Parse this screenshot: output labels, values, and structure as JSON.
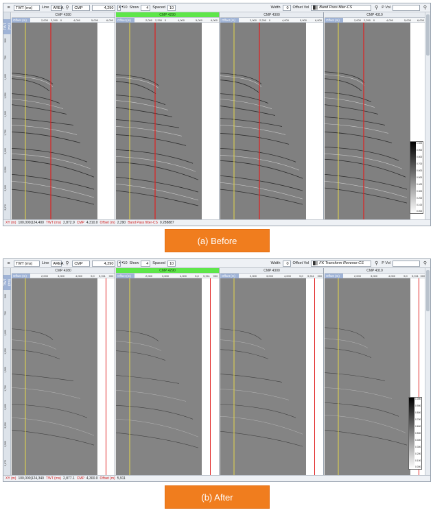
{
  "colors": {
    "selected_header": "#5ee64a",
    "caption_bg": "#f07d1e",
    "guide_red": "#e02020",
    "guide_yellow": "#e6d84a",
    "seismic_bg": "#808080"
  },
  "before": {
    "toolbar": {
      "vertical_icon": "list-icon",
      "twt_select": "TWT (ms)",
      "line_label": "Line",
      "area_value": "AREA",
      "search_icon": "search-icon",
      "cmp_select": "CMP",
      "cmp_value": "4,290",
      "show_count": "10",
      "show_label": "Show",
      "show_value": "4",
      "spaced_label": "Spaced",
      "spaced_value": "10",
      "width_label": "Width",
      "width_value": "0",
      "offset_vol_label": "Offset Vol",
      "offset_vol_value": "Band Pass filter-CS",
      "pvol_label": "P Vol",
      "pvol_value": ""
    },
    "axis": {
      "title": "TWT (ms)",
      "ticks": [
        "500",
        "750",
        "1,000",
        "1,250",
        "1,500",
        "1,750",
        "2,000",
        "2,250",
        "2,500",
        "2,670"
      ]
    },
    "offset_title": "Offset (m)",
    "panels": [
      {
        "header": "CMP 4280",
        "ticks": [
          "2,000",
          "2,290",
          "0",
          "4,000",
          "5,000",
          "6,000"
        ]
      },
      {
        "header": "CMP 4290",
        "ticks": [
          "2,000",
          "2,290",
          "0",
          "4,000",
          "5,000",
          "6,000"
        ]
      },
      {
        "header": "CMP 4300",
        "ticks": [
          "2,000",
          "2,290",
          "0",
          "4,000",
          "5,000",
          "6,000"
        ]
      },
      {
        "header": "CMP 4310",
        "ticks": [
          "2,000",
          "2,290",
          "0",
          "4,000",
          "5,000",
          "6,000"
        ]
      }
    ],
    "colorbar": {
      "labels": [
        "1.000",
        "0.900",
        "0.800",
        "0.700",
        "0.600",
        "0.500",
        "0.400",
        "0.300",
        "0.200",
        "0.100",
        "0.000"
      ]
    },
    "status": {
      "xy_label": "XY (m)",
      "xy_value": "100,000|124,400",
      "twt_label": "TWT (ms)",
      "twt_value": "2,872.9",
      "cmp_label": "CMP",
      "cmp_value": "4,310.0",
      "offset_label": "Offset (m)",
      "offset_value": "2,290",
      "vol_label": "Band Pass filter-CS",
      "vol_value": "0.288887"
    },
    "caption": "(a) Before"
  },
  "after": {
    "toolbar": {
      "vertical_icon": "list-icon",
      "twt_select": "TWT (ms)",
      "line_label": "Line",
      "area_value": "AREA",
      "search_icon": "search-icon",
      "cmp_select": "CMP",
      "cmp_value": "4,290",
      "show_count": "10",
      "show_label": "Show",
      "show_value": "4",
      "spaced_label": "Spaced",
      "spaced_value": "10",
      "width_label": "Width",
      "width_value": "0",
      "offset_vol_label": "Offset Vol",
      "offset_vol_value": "FK Transform Reverse-CS",
      "pvol_label": "P Vol",
      "pvol_value": ""
    },
    "axis": {
      "title": "TWT (ms)",
      "ticks": [
        "500",
        "750",
        "1,000",
        "1,250",
        "1,500",
        "1,750",
        "2,000",
        "2,250",
        "2,500",
        "2,670"
      ]
    },
    "offset_title": "Offset (m)",
    "panels": [
      {
        "header": "CMP 4280",
        "ticks": [
          "2,000",
          "3,000",
          "4,000",
          "5,0",
          "5,911",
          "000"
        ]
      },
      {
        "header": "CMP 4290",
        "ticks": [
          "2,000",
          "3,000",
          "4,000",
          "5,0",
          "5,911",
          "000"
        ]
      },
      {
        "header": "CMP 4300",
        "ticks": [
          "2,000",
          "3,000",
          "4,000",
          "5,0",
          "5,911",
          "000"
        ]
      },
      {
        "header": "CMP 4310",
        "ticks": [
          "2,000",
          "3,000",
          "4,000",
          "5,0",
          "5,911",
          "000"
        ]
      }
    ],
    "colorbar": {
      "labels": [
        "1.000",
        "0.900",
        "0.800",
        "0.700",
        "0.600",
        "0.500",
        "0.400",
        "0.300",
        "0.200",
        "0.100",
        "0.000"
      ]
    },
    "status": {
      "xy_label": "XY (m)",
      "xy_value": "100,000|124,340",
      "twt_label": "TWT (ms)",
      "twt_value": "2,877.1",
      "cmp_label": "CMP",
      "cmp_value": "4,300.0",
      "offset_label": "Offset (m)",
      "offset_value": "5,911",
      "vol_label": "",
      "vol_value": ""
    },
    "caption": "(b) After"
  }
}
